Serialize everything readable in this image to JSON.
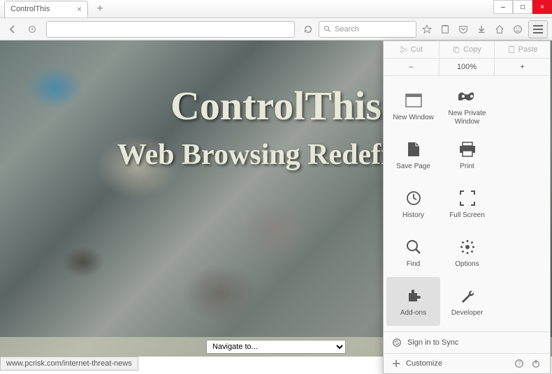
{
  "window": {
    "tab_title": "ControlThis",
    "minimize": "–",
    "maximize": "□",
    "close": "×"
  },
  "toolbar": {
    "search_placeholder": "Search"
  },
  "hero": {
    "title": "ControlThis",
    "subtitle": "Web Browsing Redefined"
  },
  "navigate": {
    "label": "Navigate to..."
  },
  "menu": {
    "edit": {
      "cut": "Cut",
      "copy": "Copy",
      "paste": "Paste"
    },
    "zoom": {
      "minus": "–",
      "level": "100%",
      "plus": "+"
    },
    "grid": {
      "new_window": "New Window",
      "new_private": "New Private Window",
      "save_page": "Save Page",
      "print": "Print",
      "history": "History",
      "full_screen": "Full Screen",
      "find": "Find",
      "options": "Options",
      "addons": "Add-ons",
      "developer": "Developer"
    },
    "signin": "Sign in to Sync",
    "customize": "Customize"
  },
  "statusbar": {
    "url": "www.pcrisk.com/internet-threat-news"
  }
}
